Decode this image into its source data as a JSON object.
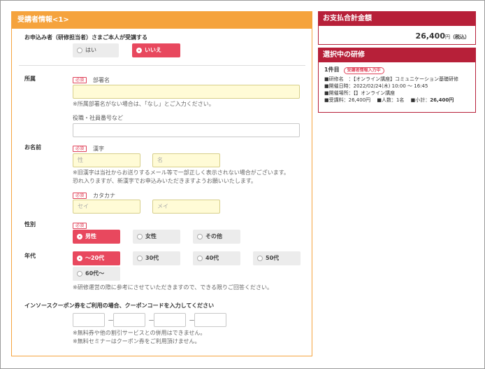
{
  "form": {
    "header_title": "受講者情報<1>",
    "applicant_question": "お申込み者（研修担当者）さまご本人が受講する",
    "applicant_options": [
      "はい",
      "いいえ"
    ],
    "applicant_selected": "いいえ",
    "required_label": "必須",
    "affiliation": {
      "section_label": "所属",
      "dept_label": "部署名",
      "dept_note": "※所属部署名がない場合は、「なし」とご入力ください。",
      "position_label": "役職・社員番号など"
    },
    "name": {
      "section_label": "お名前",
      "kanji_label": "漢字",
      "last_placeholder": "性",
      "first_placeholder": "名",
      "note1": "※旧漢字は当社からお送りするメール等で一部正しく表示されない場合がございます。",
      "note2": "恐れ入りますが、新漢字でお申込みいただきますようお願いいたします。",
      "kana_label": "カタカナ",
      "kana_last_placeholder": "セイ",
      "kana_first_placeholder": "メイ"
    },
    "gender": {
      "section_label": "性別",
      "options": [
        "男性",
        "女性",
        "その他"
      ],
      "selected": "男性"
    },
    "age": {
      "section_label": "年代",
      "options": [
        "～20代",
        "30代",
        "40代",
        "50代",
        "60代～"
      ],
      "selected": "～20代",
      "note": "※研修運営の際に参考にさせていただきますので、できる限りご回答ください。"
    },
    "coupon": {
      "question": "インソースクーポン券をご利用の場合、クーポンコードを入力してください",
      "separator": "－",
      "note1": "※無料券や他の割引サービスとの併用はできません。",
      "note2": "※無料セミナーはクーポン券をご利用頂けません。"
    }
  },
  "summary": {
    "total_title": "お支払合計金額",
    "total_amount": "26,400",
    "total_unit": "円",
    "total_tax": "（税込）",
    "course_title": "選択中の研修",
    "course_no": "1件目",
    "course_badge": "受講者情報入力中",
    "course_name": "■研修名　：【オンライン講座】コミュニケーション基礎研修",
    "course_date": "■開催日時：2022/02/24(木) 10:00 ～ 16:45",
    "course_place": "■開催場所：【】オンライン講座",
    "course_fee": "■受講料：26,400円",
    "course_people": "■人数：1名",
    "course_subtotal_label": "■小計：",
    "course_subtotal": "26,400円"
  },
  "colors": {
    "orange": "#f5a33d",
    "crimson": "#b72039",
    "selected_pink": "#e8485e"
  }
}
